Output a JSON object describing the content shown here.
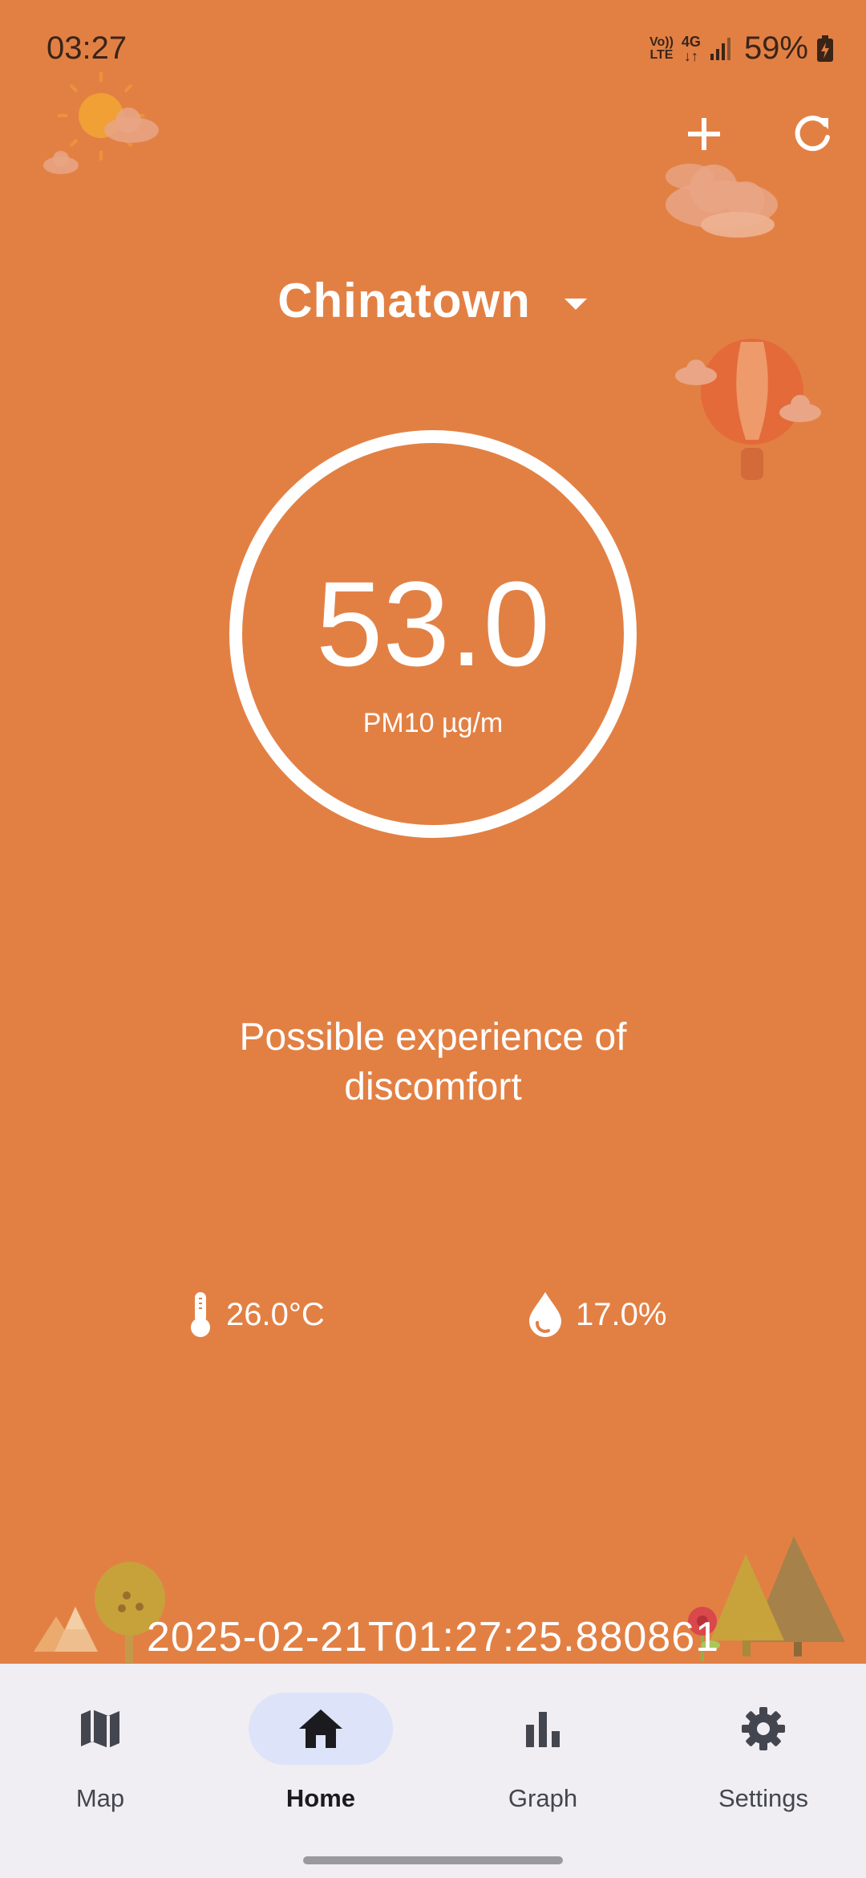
{
  "status_bar": {
    "time": "03:27",
    "volte_label": "Vo)) LTE",
    "network_label": "4G",
    "battery_percent": "59%"
  },
  "header": {
    "add_icon": "plus-icon",
    "refresh_icon": "refresh-icon"
  },
  "location": {
    "name": "Chinatown",
    "dropdown_icon": "caret-down-icon"
  },
  "reading": {
    "value": "53.0",
    "unit": "PM10 µg/m"
  },
  "message": "Possible experience of discomfort",
  "metrics": {
    "temperature": "26.0°C",
    "humidity": "17.0%"
  },
  "timestamp": "2025-02-21T01:27:25.880861",
  "bottom_nav": {
    "items": [
      {
        "label": "Map",
        "icon": "map-icon",
        "active": false
      },
      {
        "label": "Home",
        "icon": "home-icon",
        "active": true
      },
      {
        "label": "Graph",
        "icon": "bar-chart-icon",
        "active": false
      },
      {
        "label": "Settings",
        "icon": "gear-icon",
        "active": false
      }
    ]
  },
  "colors": {
    "background": "#E28044",
    "nav_background": "#F0EEF3",
    "active_pill": "#DDE3F8",
    "text": "#FFFFFF"
  }
}
